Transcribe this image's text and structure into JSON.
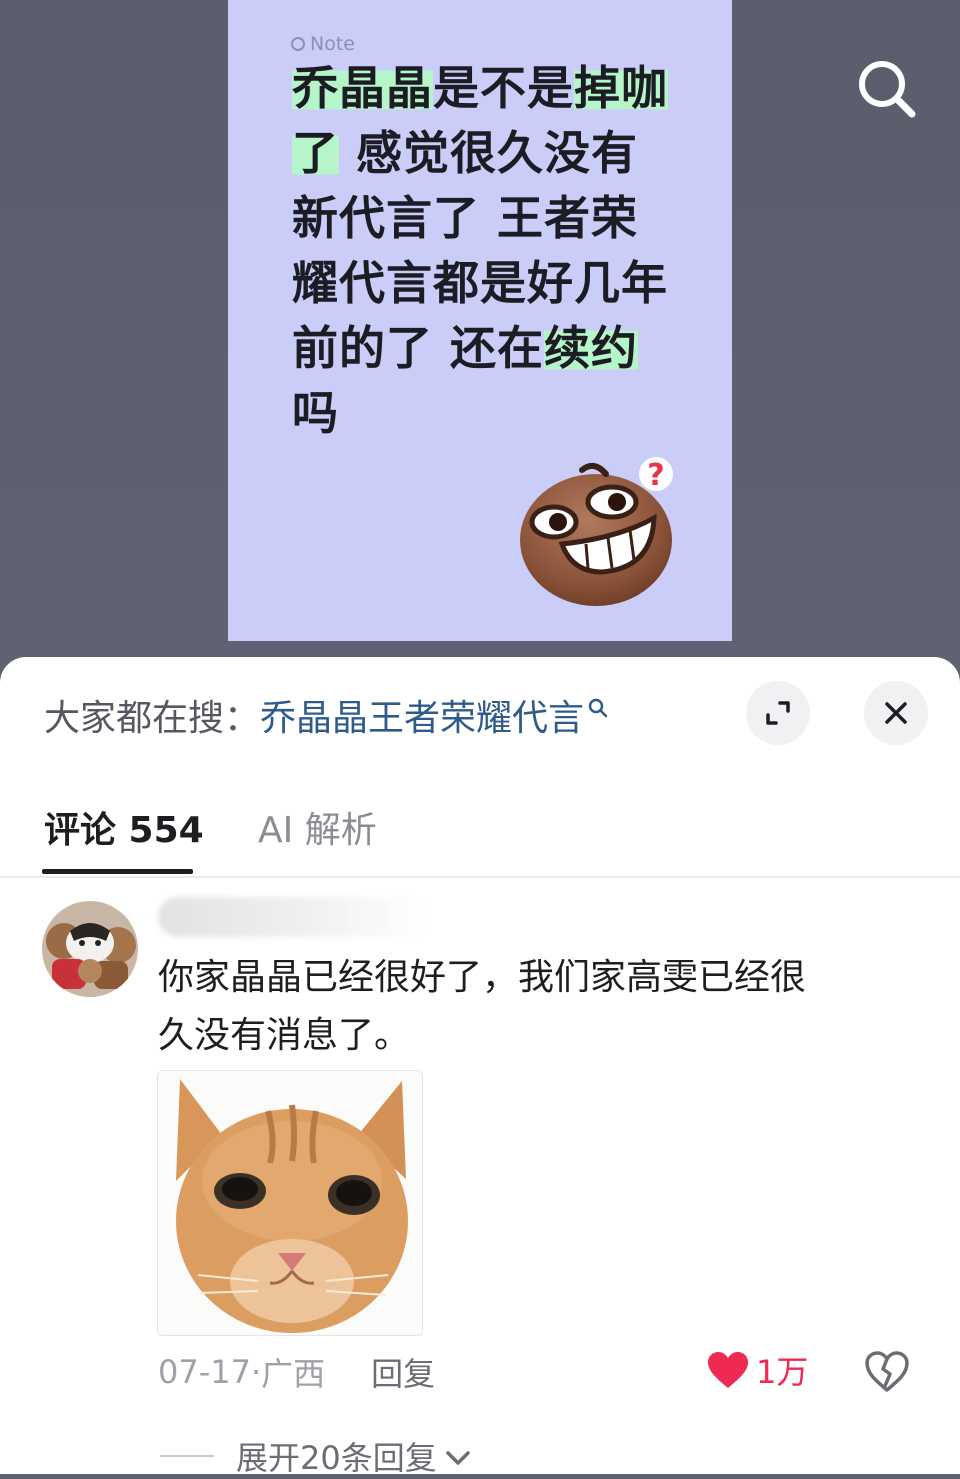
{
  "note": {
    "tag": "Note",
    "lines": [
      {
        "pre": "",
        "hl": "乔晶晶",
        "post": "是不是",
        "hl2": "掉咖"
      },
      {
        "pre": "",
        "hl": "了",
        "post": " 感觉很久没有",
        "hl2": ""
      },
      {
        "pre": "新代言了 王者荣",
        "hl": "",
        "post": "",
        "hl2": ""
      },
      {
        "pre": "耀代言都是好几年",
        "hl": "",
        "post": "",
        "hl2": ""
      },
      {
        "pre": "前的了 还在",
        "hl": "续约",
        "post": "",
        "hl2": ""
      },
      {
        "pre": "吗",
        "hl": "",
        "post": "",
        "hl2": ""
      }
    ]
  },
  "sheet": {
    "search_prefix": "大家都在搜：",
    "search_query": "乔晶晶王者荣耀代言",
    "tabs": {
      "comments": "评论 554",
      "ai": "AI 解析"
    }
  },
  "comment": {
    "text_lines": [
      "你家晶晶已经很好了，我们家高雯已经很",
      "久没有消息了。"
    ],
    "date": "07-17",
    "separator": " · ",
    "location": "广西",
    "reply_label": "回复",
    "like_count": "1万",
    "expand_replies": "展开20条回复"
  },
  "colors": {
    "note_bg": "#c9cdf7",
    "highlight": "#b6f5c9",
    "link": "#2f5b8a",
    "like": "#ee2a52"
  },
  "icons": [
    "search-icon",
    "ring-icon",
    "mini-search-icon",
    "expand-icon",
    "close-icon",
    "heart-icon",
    "broken-heart-icon",
    "chevron-down-icon"
  ]
}
